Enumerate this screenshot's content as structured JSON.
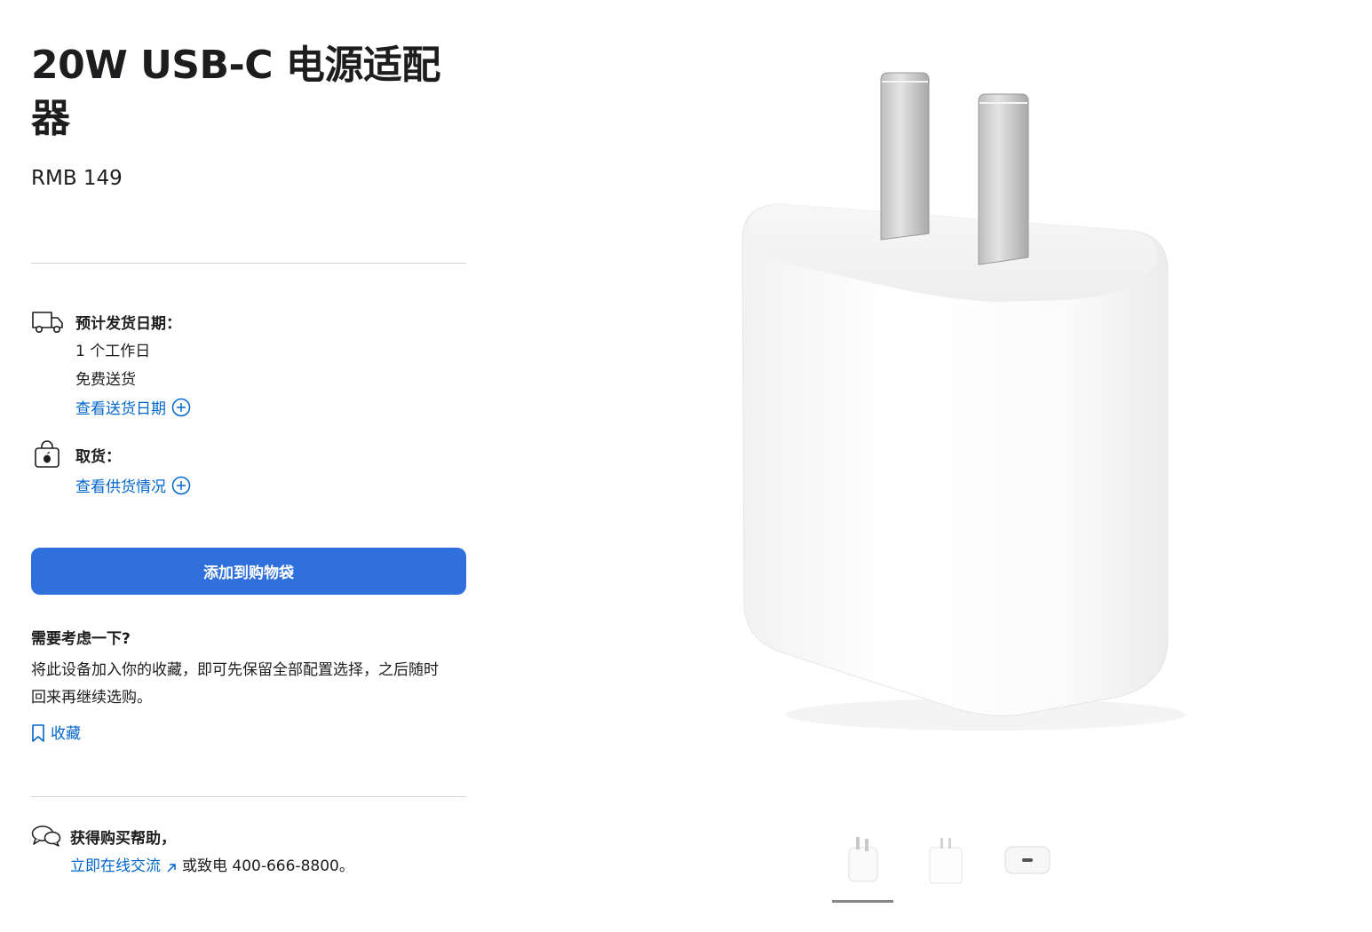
{
  "product": {
    "title": "20W USB-C 电源适配器",
    "price": "RMB 149"
  },
  "delivery": {
    "label": "预计发货日期：",
    "lines": [
      "1 个工作日",
      "免费送货"
    ],
    "link": "查看送货日期"
  },
  "pickup": {
    "label": "取货：",
    "link": "查看供货情况"
  },
  "cart": {
    "button_label": "添加到购物袋"
  },
  "consider": {
    "title": "需要考虑一下?",
    "body": "将此设备加入你的收藏，即可先保留全部配置选择，之后随时回来再继续选购。",
    "save_label": "收藏"
  },
  "help": {
    "title": "获得购买帮助，",
    "chat_link": "立即在线交流",
    "phone_text": "或致电 400-666-8800。"
  },
  "gallery": {
    "thumbnails": [
      "front-view",
      "back-view",
      "usb-c-port-view"
    ],
    "selected_index": 0
  },
  "colors": {
    "accent": "#2f70dc",
    "link": "#0066cc",
    "divider": "#d2d2d7"
  }
}
